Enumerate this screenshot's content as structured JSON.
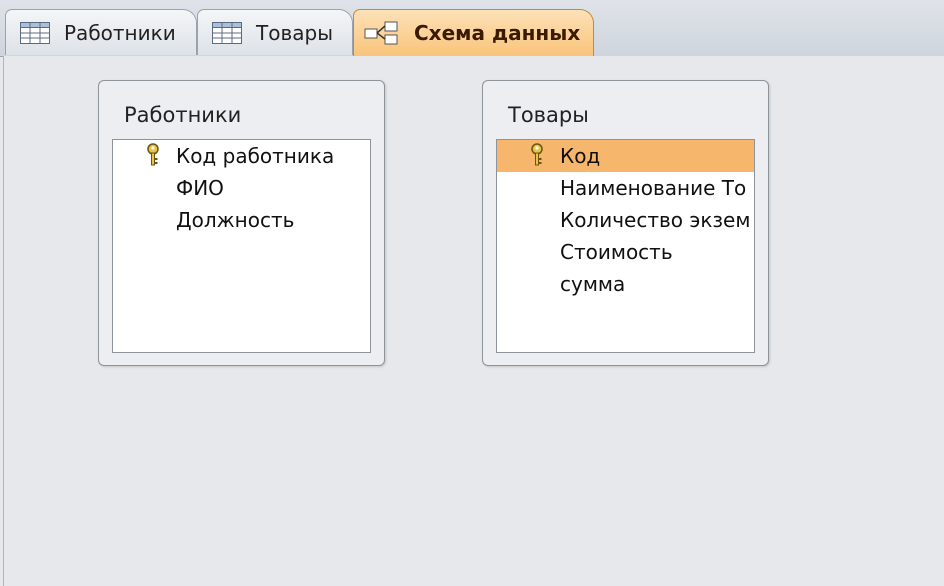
{
  "tabs": [
    {
      "label": "Работники",
      "icon": "table-icon",
      "active": false
    },
    {
      "label": "Товары",
      "icon": "table-icon",
      "active": false
    },
    {
      "label": "Схема данных",
      "icon": "relationships-icon",
      "active": true
    }
  ],
  "tables": [
    {
      "title": "Работники",
      "fields": [
        {
          "label": "Код работника",
          "primary_key": true
        },
        {
          "label": "ФИО"
        },
        {
          "label": "Должность"
        }
      ]
    },
    {
      "title": "Товары",
      "fields": [
        {
          "label": "Код",
          "primary_key": true,
          "selected": true
        },
        {
          "label": "Наименование То"
        },
        {
          "label": "Количество экзем"
        },
        {
          "label": "Стоимость"
        },
        {
          "label": "сумма"
        }
      ]
    }
  ],
  "colors": {
    "active_tab": "#f9c47a",
    "selected_row": "#f6b66c",
    "background": "#e6e8eb"
  }
}
